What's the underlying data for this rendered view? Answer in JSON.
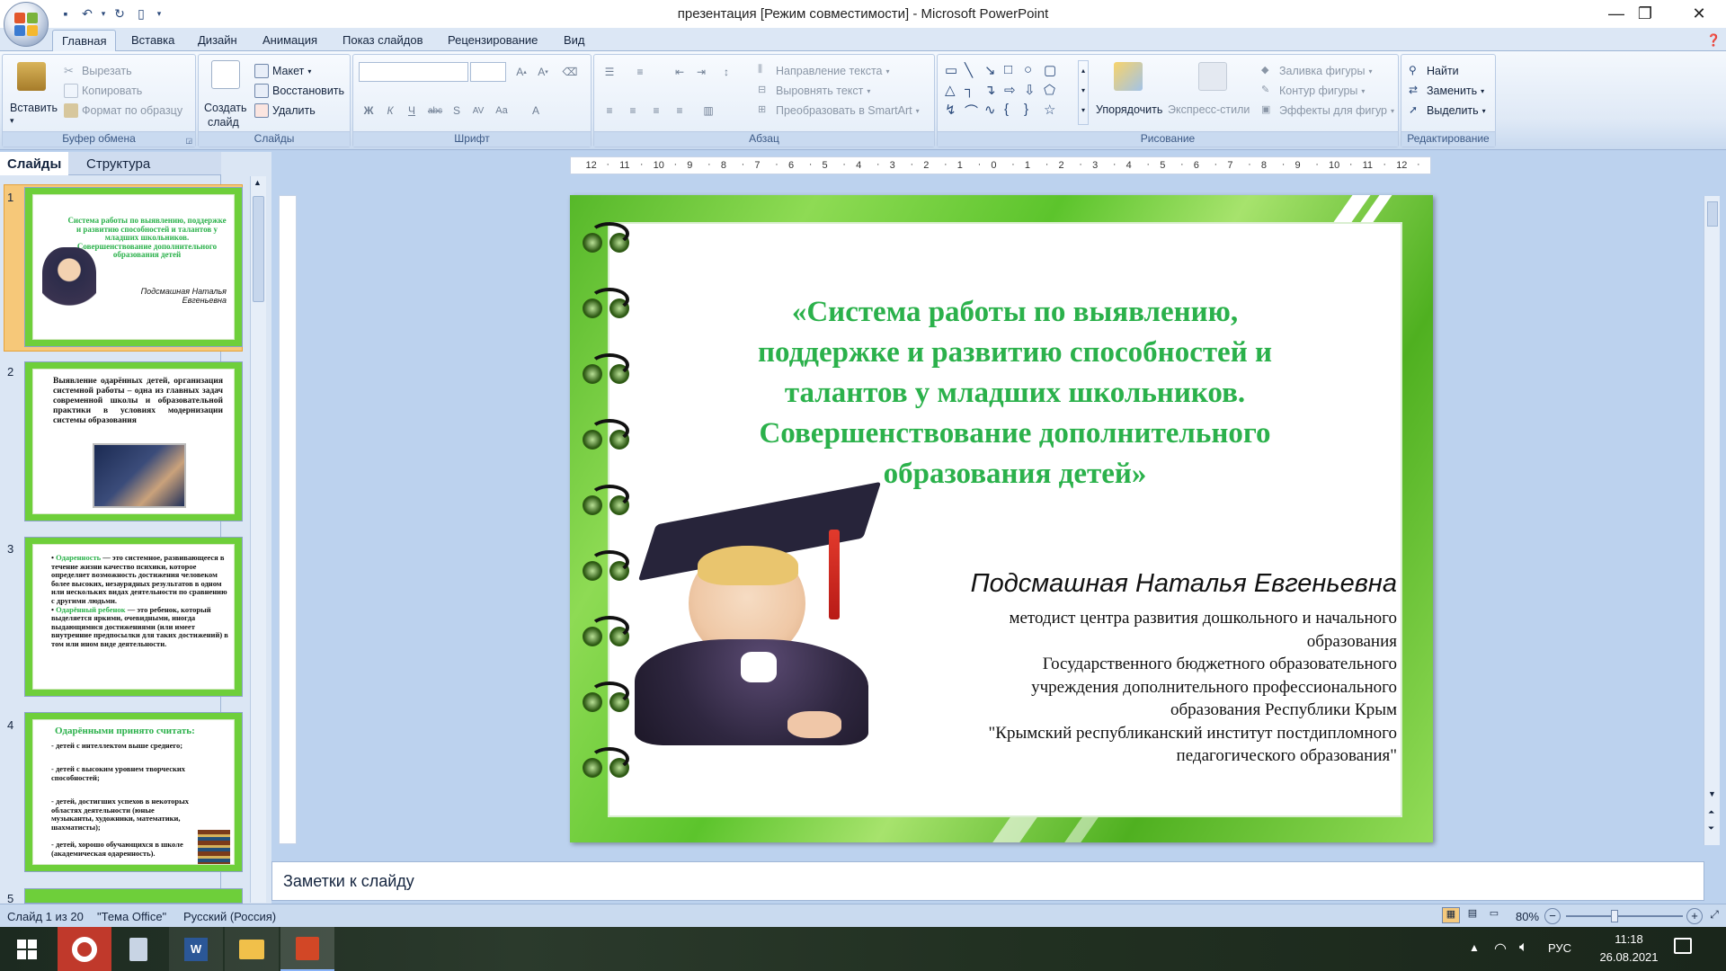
{
  "window": {
    "title": "презентация [Режим совместимости] - Microsoft PowerPoint"
  },
  "tabs": [
    "Главная",
    "Вставка",
    "Дизайн",
    "Анимация",
    "Показ слайдов",
    "Рецензирование",
    "Вид"
  ],
  "ribbon": {
    "clipboard": {
      "name": "Буфер обмена",
      "paste": "Вставить",
      "cut": "Вырезать",
      "copy": "Копировать",
      "format_painter": "Формат по образцу"
    },
    "slides": {
      "name": "Слайды",
      "new_slide_1": "Создать",
      "new_slide_2": "слайд",
      "layout": "Макет",
      "reset": "Восстановить",
      "delete": "Удалить"
    },
    "font": {
      "name": "Шрифт"
    },
    "paragraph": {
      "name": "Абзац",
      "text_direction": "Направление текста",
      "align_text": "Выровнять текст",
      "smartart": "Преобразовать в SmartArt"
    },
    "drawing": {
      "name": "Рисование",
      "arrange": "Упорядочить",
      "quick_styles": "Экспресс-стили",
      "shape_fill": "Заливка фигуры",
      "shape_outline": "Контур фигуры",
      "shape_effects": "Эффекты для фигур"
    },
    "editing": {
      "name": "Редактирование",
      "find": "Найти",
      "replace": "Заменить",
      "select": "Выделить"
    }
  },
  "left_panel": {
    "tab_slides": "Слайды",
    "tab_outline": "Структура",
    "thumbs": [
      {
        "num": "1",
        "title": "Система работы по выявлению, поддержке и развитию способностей и талантов у младших школьников. Совершенствование дополнительного образования детей",
        "author": "Подсмашная Наталья Евгеньевна"
      },
      {
        "num": "2",
        "text": "Выявление одарённых детей, организация системной работы – одна из главных задач современной школы и образовательной практики в условиях модернизации системы образования"
      },
      {
        "num": "3",
        "text_a_head": "Одаренность",
        "text_a": " — это системное, развивающееся в течение жизни качество психики, которое определяет возможность достижения человеком более высоких, незаурядных результатов в одном или нескольких видах деятельности по сравнению с другими людьми.",
        "text_b_head": "Одарённый ребенок",
        "text_b": " — это ребенок, который выделяется яркими, очевидными, иногда выдающимися достижениями (или имеет внутренние предпосылки для таких достижений) в том или ином виде деятельности."
      },
      {
        "num": "4",
        "head": "Одарёнными принято считать:",
        "l1": "- детей с интеллектом выше среднего;",
        "l2": "- детей с высоким уровнем творческих способностей;",
        "l3": "- детей, достигших успехов в некоторых областях деятельности (юные музыканты, художники, математики, шахматисты);",
        "l4": "- детей, хорошо обучающихся в школе (академическая одаренность)."
      },
      {
        "num": "5"
      }
    ]
  },
  "ruler": {
    "h_ticks": [
      "12",
      "11",
      "10",
      "9",
      "8",
      "7",
      "6",
      "5",
      "4",
      "3",
      "2",
      "1",
      "0",
      "1",
      "2",
      "3",
      "4",
      "5",
      "6",
      "7",
      "8",
      "9",
      "10",
      "11",
      "12"
    ]
  },
  "slide": {
    "title_l1": "«Система работы по выявлению,",
    "title_l2": "поддержке и развитию способностей и",
    "title_l3": "талантов у младших школьников.",
    "title_l4": "Совершенствование  дополнительного",
    "title_l5": "образования детей»",
    "author": "Подсмашная Наталья Евгеньевна",
    "info_l1": "методист центра развития дошкольного и начального",
    "info_l2": "образования",
    "info_l3": "Государственного бюджетного образовательного",
    "info_l4": "учреждения дополнительного профессионального",
    "info_l5": "образования Республики Крым",
    "info_l6": "\"Крымский республиканский институт постдипломного",
    "info_l7": "педагогического образования\""
  },
  "notes": {
    "placeholder": "Заметки к слайду"
  },
  "status": {
    "slide": "Слайд 1 из 20",
    "theme": "\"Тема Office\"",
    "lang": "Русский (Россия)",
    "zoom": "80%"
  },
  "taskbar": {
    "lang": "РУС",
    "time": "11:18",
    "date": "26.08.2021"
  },
  "colors": {
    "title_green": "#2bb14b",
    "slide_frame": "#6cce36",
    "ribbon_blue": "#dce7f5"
  }
}
